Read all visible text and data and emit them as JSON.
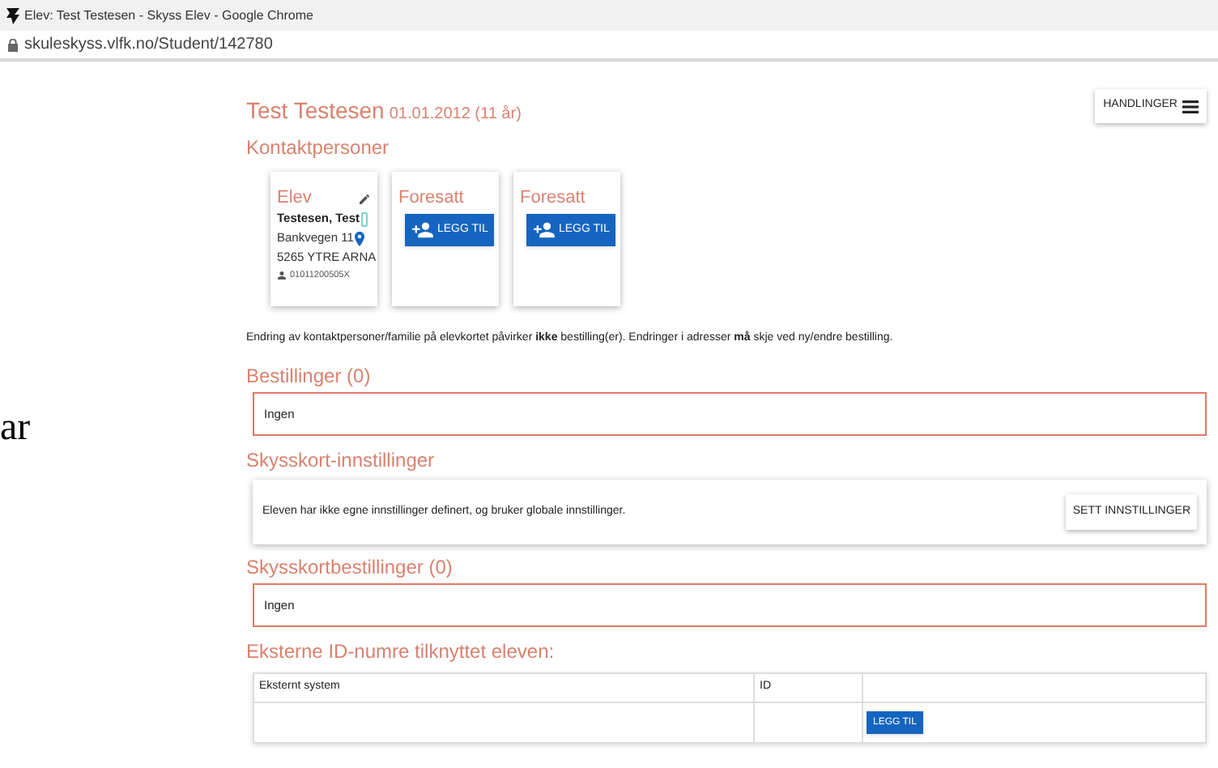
{
  "window": {
    "title": "Elev: Test Testesen - Skyss Elev - Google Chrome"
  },
  "address_bar": {
    "url": "skuleskyss.vlfk.no/Student/142780"
  },
  "side_fragment": {
    "text": "ar"
  },
  "header": {
    "name": "Test Testesen",
    "birth": "01.01.2012 (11 år)",
    "actions_button": "HANDLINGER"
  },
  "contacts": {
    "title": "Kontaktpersoner",
    "cards": [
      {
        "kind": "student",
        "title": "Elev",
        "name": "Testesen, Test",
        "street": "Bankvegen 11",
        "city": "5265 YTRE ARNA",
        "id_number": "01011200505X"
      },
      {
        "kind": "empty",
        "title": "Foresatt",
        "button": "LEGG TIL"
      },
      {
        "kind": "empty",
        "title": "Foresatt",
        "button": "LEGG TIL"
      }
    ]
  },
  "notice": "Endring av kontaktpersoner/familie på elevkortet påvirker **ikke** bestilling(er). Endringer i adresser **må** skje ved ny/endre bestilling.",
  "orders": {
    "title": "Bestillinger (0)",
    "content": "Ingen"
  },
  "card_settings": {
    "title": "Skysskort-innstillinger",
    "text": "Eleven har ikke egne innstillinger definert, og bruker globale innstillinger.",
    "button": "SETT INNSTILLINGER"
  },
  "card_orders": {
    "title": "Skysskortbestillinger (0)",
    "content": "Ingen"
  },
  "external_ids": {
    "title": "Eksterne ID-numre tilknyttet eleven:",
    "columns": [
      "Eksternt system",
      "ID"
    ],
    "add_button": "LEGG TIL"
  }
}
